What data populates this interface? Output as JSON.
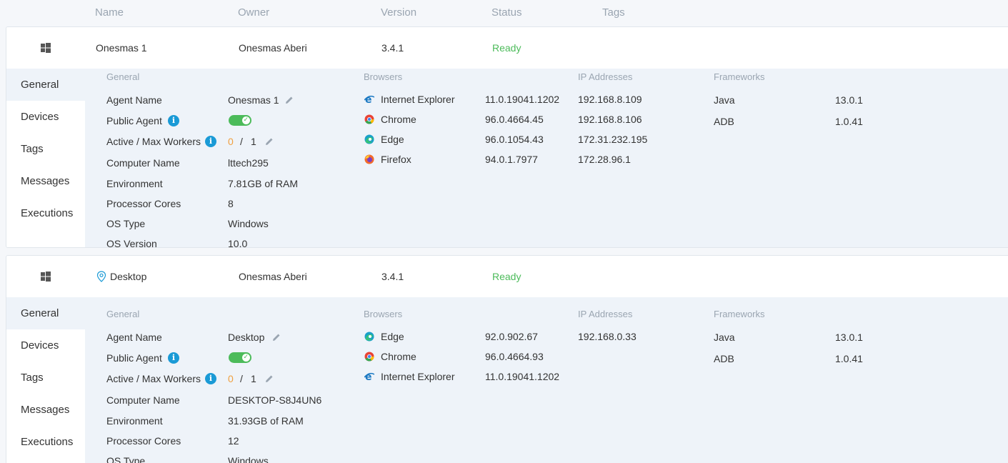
{
  "columns": {
    "name": "Name",
    "owner": "Owner",
    "version": "Version",
    "status": "Status",
    "tags": "Tags"
  },
  "nav": [
    "General",
    "Devices",
    "Tags",
    "Messages",
    "Executions"
  ],
  "section_titles": {
    "general": "General",
    "browsers": "Browsers",
    "ip": "IP Addresses",
    "frameworks": "Frameworks"
  },
  "labels": {
    "agent_name": "Agent Name",
    "public_agent": "Public Agent",
    "workers": "Active / Max Workers",
    "computer_name": "Computer Name",
    "environment": "Environment",
    "cores": "Processor Cores",
    "os_type": "OS Type",
    "os_version": "OS Version",
    "slash": "/"
  },
  "agents": [
    {
      "name": "Onesmas 1",
      "owner": "Onesmas Aberi",
      "version": "3.4.1",
      "status": "Ready",
      "agent_name": "Onesmas 1",
      "active_workers": "0",
      "max_workers": "1",
      "computer_name": "lttech295",
      "environment": "7.81GB of RAM",
      "cores": "8",
      "os_type": "Windows",
      "os_version": "10.0",
      "browsers": [
        {
          "name": "Internet Explorer",
          "version": "11.0.19041.1202",
          "icon": "ie-icon"
        },
        {
          "name": "Chrome",
          "version": "96.0.4664.45",
          "icon": "chrome-icon"
        },
        {
          "name": "Edge",
          "version": "96.0.1054.43",
          "icon": "edge-icon"
        },
        {
          "name": "Firefox",
          "version": "94.0.1.7977",
          "icon": "firefox-icon"
        }
      ],
      "ips": [
        "192.168.8.109",
        "192.168.8.106",
        "172.31.232.195",
        "172.28.96.1"
      ],
      "frameworks": [
        {
          "name": "Java",
          "version": "13.0.1"
        },
        {
          "name": "ADB",
          "version": "1.0.41"
        }
      ]
    },
    {
      "name": "Desktop",
      "owner": "Onesmas Aberi",
      "version": "3.4.1",
      "status": "Ready",
      "agent_name": "Desktop",
      "active_workers": "0",
      "max_workers": "1",
      "computer_name": "DESKTOP-S8J4UN6",
      "environment": "31.93GB of RAM",
      "cores": "12",
      "os_type": "Windows",
      "browsers": [
        {
          "name": "Edge",
          "version": "92.0.902.67",
          "icon": "edge-icon"
        },
        {
          "name": "Chrome",
          "version": "96.0.4664.93",
          "icon": "chrome-icon"
        },
        {
          "name": "Internet Explorer",
          "version": "11.0.19041.1202",
          "icon": "ie-icon"
        }
      ],
      "ips": [
        "192.168.0.33"
      ],
      "frameworks": [
        {
          "name": "Java",
          "version": "13.0.1"
        },
        {
          "name": "ADB",
          "version": "1.0.41"
        }
      ]
    }
  ],
  "colors": {
    "status_ready": "#4cbb5a",
    "info": "#1a9ad6",
    "toggle_on": "#4cbb5a",
    "workers_active": "#f0a040"
  }
}
